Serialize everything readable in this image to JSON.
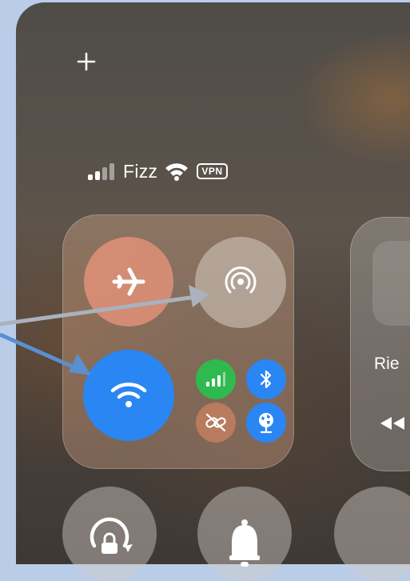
{
  "status_bar": {
    "carrier": "Fizz",
    "vpn_badge": "VPN"
  },
  "media": {
    "title_visible": "Rie"
  },
  "controls": {
    "airplane_mode": {
      "icon": "airplane-icon",
      "active": true,
      "color": "#e1917a"
    },
    "airdrop": {
      "icon": "airdrop-icon",
      "active": false
    },
    "wifi": {
      "icon": "wifi-icon",
      "active": true,
      "color": "#2a86f3"
    },
    "cellular": {
      "icon": "cellular-icon",
      "active": true,
      "color": "#2fb94f"
    },
    "bluetooth": {
      "icon": "bluetooth-icon",
      "active": true,
      "color": "#2a86f3"
    },
    "personal_hotspot": {
      "icon": "hotspot-link-icon",
      "active": false
    },
    "vpn": {
      "icon": "globe-icon",
      "active": true,
      "color": "#2a86f3"
    },
    "rotation_lock": {
      "icon": "rotation-lock-icon"
    },
    "silent_mode": {
      "icon": "bell-icon"
    }
  },
  "annotations": {
    "arrow_color": "#5a8fd0"
  }
}
